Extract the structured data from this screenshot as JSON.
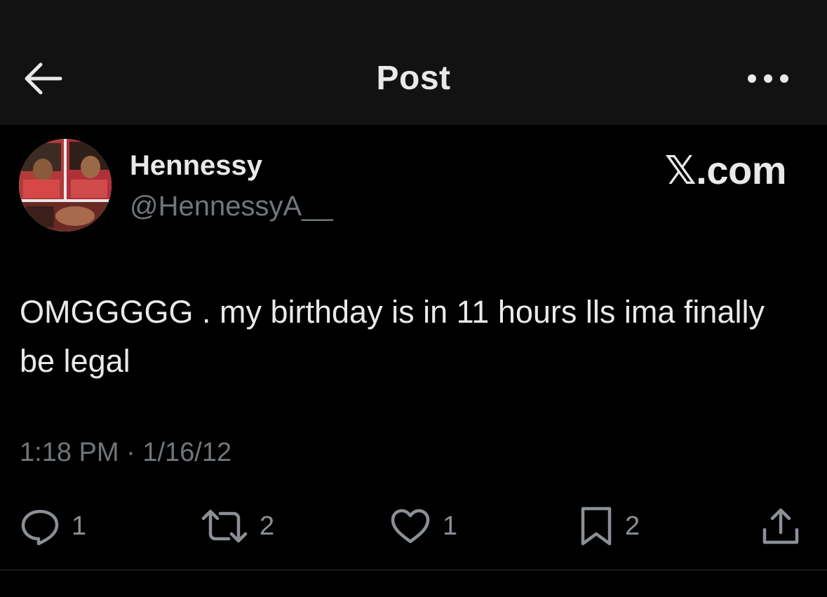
{
  "header": {
    "title": "Post",
    "back_icon": "arrow-left-icon",
    "more_icon": "more-horizontal-icon"
  },
  "author": {
    "display_name": "Hennessy",
    "handle": "@HennessyA__"
  },
  "brand": "𝕏.com",
  "post": {
    "text": "OMGGGGG . my birthday is in 11 hours lls ima finally be legal",
    "time": "1:18 PM",
    "separator": "·",
    "date": "1/16/12"
  },
  "actions": {
    "replies": "1",
    "reposts": "2",
    "likes": "1",
    "bookmarks": "2"
  },
  "colors": {
    "background": "#000000",
    "header_background": "#121212",
    "primary_text": "#e7e9ea",
    "secondary_text": "#71767b"
  }
}
